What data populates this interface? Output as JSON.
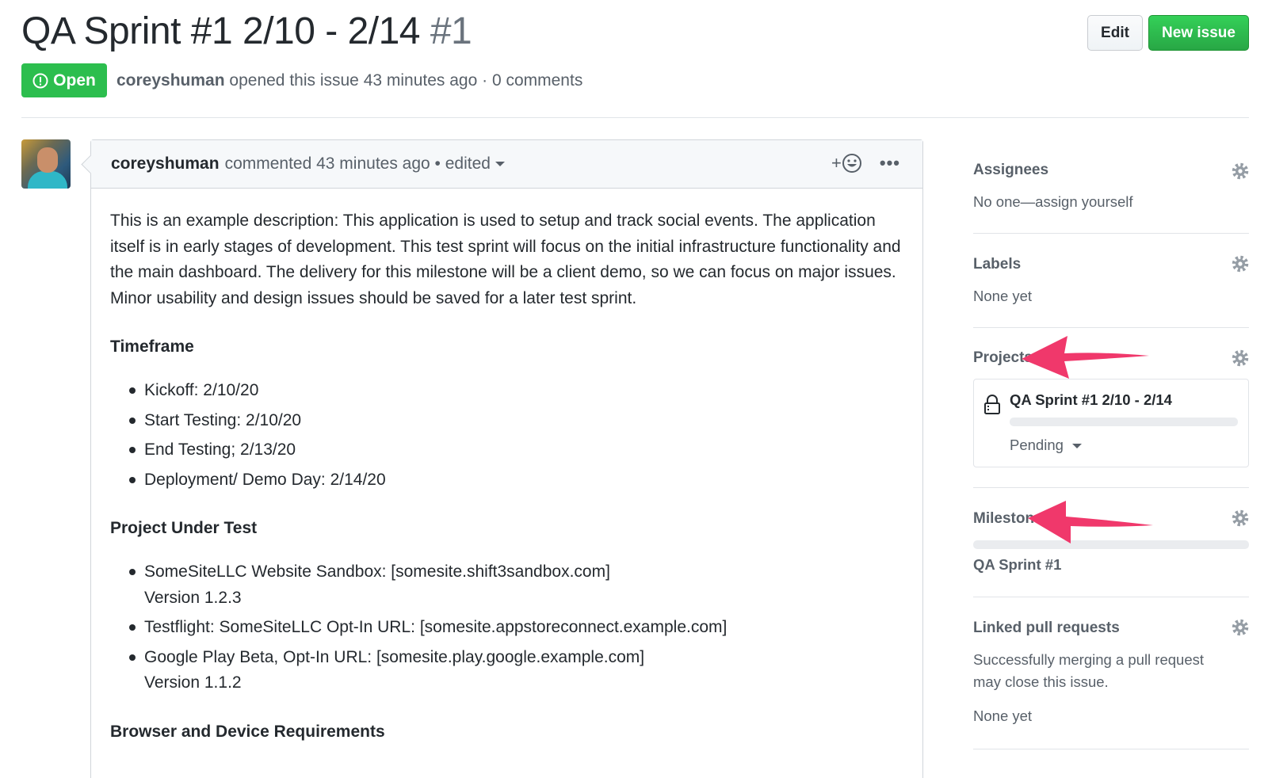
{
  "header": {
    "title": "QA Sprint #1 2/10 - 2/14",
    "issue_number": "#1",
    "edit_label": "Edit",
    "new_issue_label": "New issue"
  },
  "status": {
    "state": "Open",
    "author": "coreyshuman",
    "opened_text": "opened this issue 43 minutes ago · 0 comments",
    "colors": {
      "open": "#2cbe4e",
      "primary_button": "#28a745"
    }
  },
  "comment": {
    "author": "coreyshuman",
    "meta": "commented 43 minutes ago • edited",
    "reaction_icon": "smiley-icon",
    "more_icon": "kebab-horizontal-icon",
    "description": "This is an example description: This application is used to setup and track social events. The application itself is in early stages of development. This test sprint will focus on the initial infrastructure functionality and the main dashboard. The delivery for this milestone will be a client demo, so we can focus on major issues. Minor usability and design issues should be saved for a later test sprint.",
    "timeframe_heading": "Timeframe",
    "timeframe": [
      "Kickoff: 2/10/20",
      "Start Testing: 2/10/20",
      "End Testing; 2/13/20",
      "Deployment/ Demo Day: 2/14/20"
    ],
    "project_heading": "Project Under Test",
    "projects": [
      {
        "line1": "SomeSiteLLC Website Sandbox: [somesite.shift3sandbox.com]",
        "line2": "Version 1.2.3"
      },
      {
        "line1": "Testflight: SomeSiteLLC Opt-In URL: [somesite.appstoreconnect.example.com]",
        "line2": ""
      },
      {
        "line1": "Google Play Beta, Opt-In URL: [somesite.play.google.example.com]",
        "line2": "Version 1.1.2"
      }
    ],
    "browser_heading": "Browser and Device Requirements"
  },
  "sidebar": {
    "assignees": {
      "heading": "Assignees",
      "value": "No one—assign yourself"
    },
    "labels": {
      "heading": "Labels",
      "value": "None yet"
    },
    "projects": {
      "heading": "Projects",
      "card_title": "QA Sprint #1 2/10 - 2/14",
      "card_status": "Pending"
    },
    "milestone": {
      "heading": "Milestone",
      "value": "QA Sprint #1"
    },
    "linked_prs": {
      "heading": "Linked pull requests",
      "line1": "Successfully merging a pull request",
      "line2": "may close this issue.",
      "value": "None yet"
    }
  },
  "annotations": {
    "arrow_color": "#f0386b"
  }
}
